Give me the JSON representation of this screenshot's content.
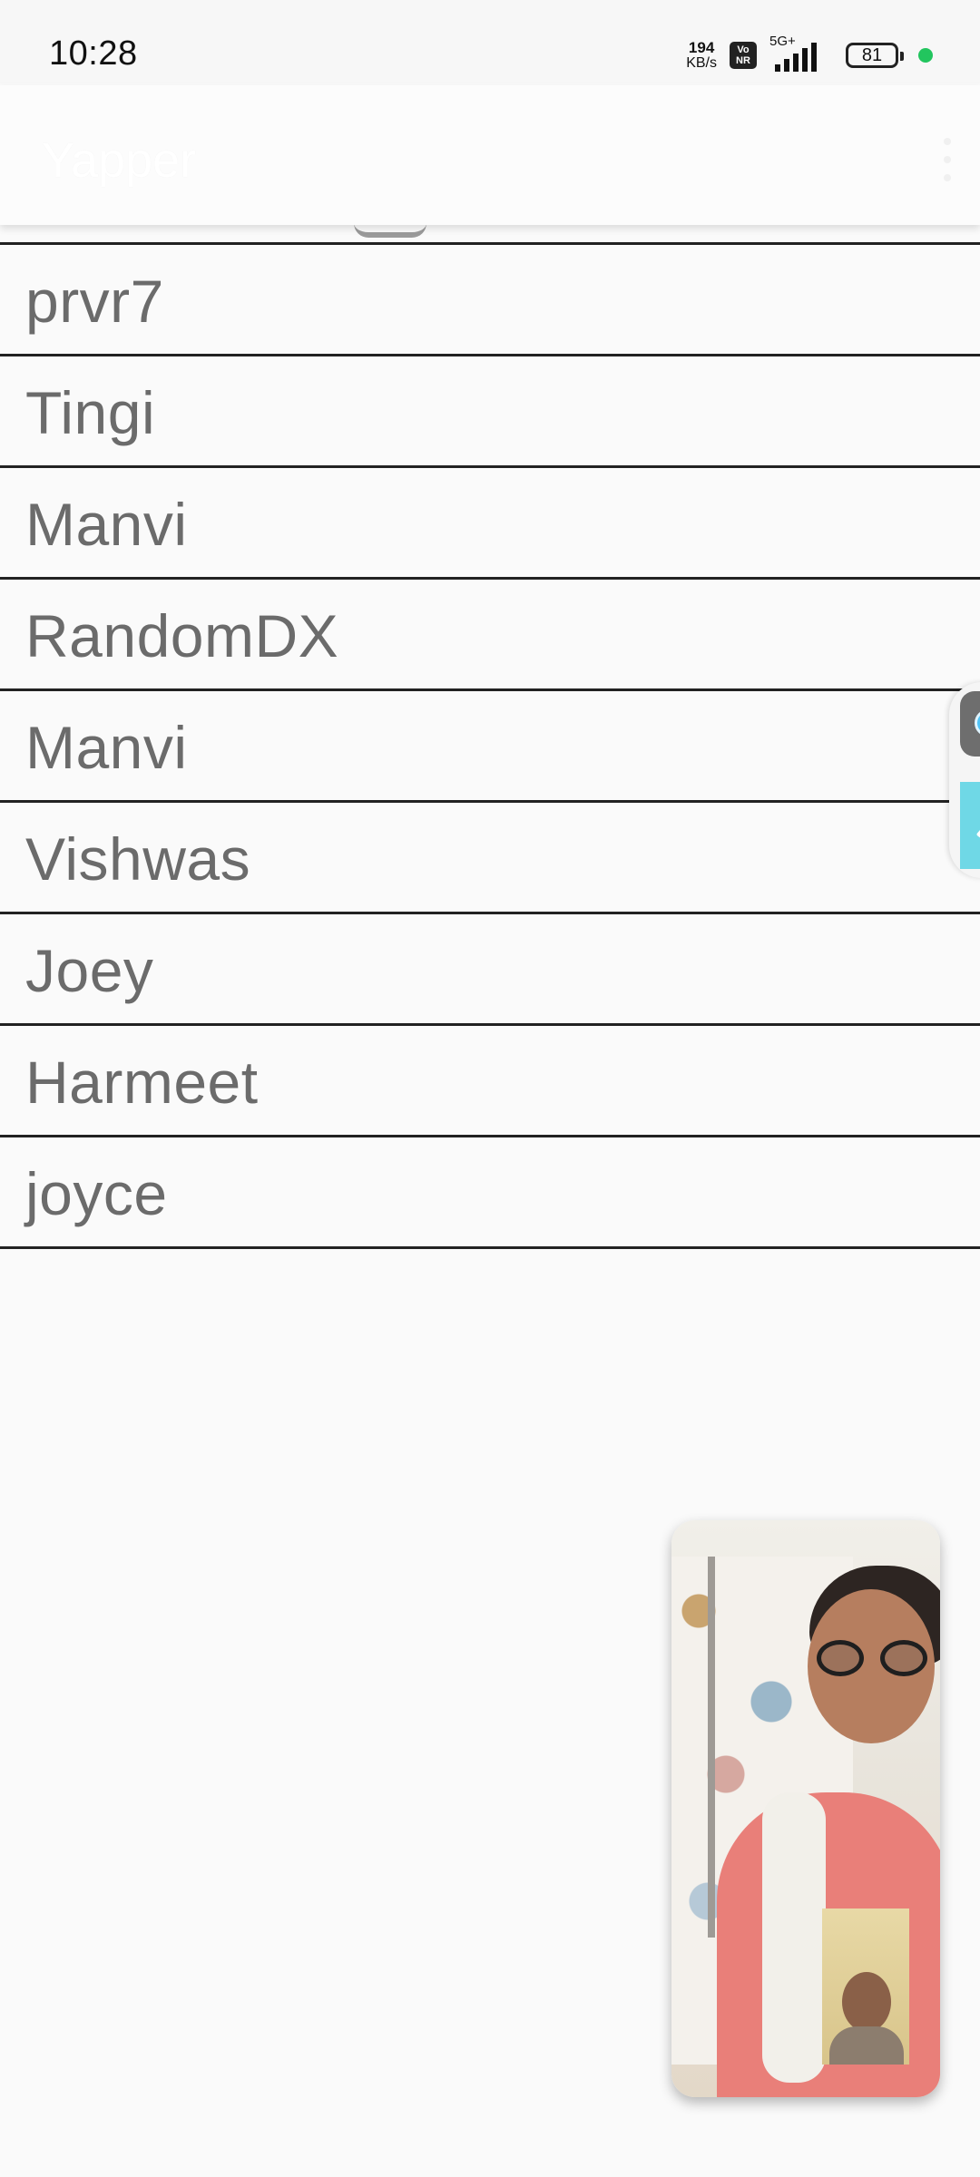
{
  "status_bar": {
    "time": "10:28",
    "net_speed_value": "194",
    "net_speed_unit": "KB/s",
    "volte_top": "Vo",
    "volte_bottom": "NR",
    "network_gen": "5G+",
    "battery_level": "81"
  },
  "app_bar": {
    "title": "Yapper"
  },
  "list": {
    "items": [
      {
        "label": "prvr7"
      },
      {
        "label": "Tingi"
      },
      {
        "label": "Manvi"
      },
      {
        "label": "RandomDX"
      },
      {
        "label": "Manvi"
      },
      {
        "label": "Vishwas"
      },
      {
        "label": "Joey"
      },
      {
        "label": "Harmeet"
      },
      {
        "label": "joyce"
      }
    ]
  },
  "colors": {
    "background": "#fafafa",
    "divider": "#222222",
    "item_text": "#6b6b6b",
    "side_accent": "#6fd8e6",
    "status_dot": "#22c55e"
  }
}
